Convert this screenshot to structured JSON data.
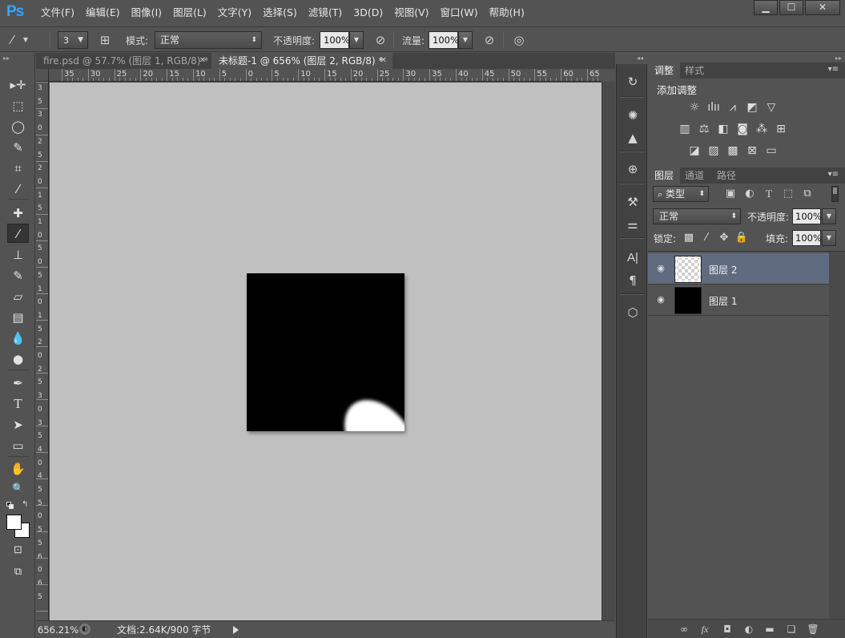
{
  "app": {
    "logo": "Ps"
  },
  "menu": [
    "文件(F)",
    "编辑(E)",
    "图像(I)",
    "图层(L)",
    "文字(Y)",
    "选择(S)",
    "滤镜(T)",
    "3D(D)",
    "视图(V)",
    "窗口(W)",
    "帮助(H)"
  ],
  "window_buttons": {
    "minimize": "▁",
    "maximize": "☐",
    "close": "✕"
  },
  "options": {
    "brush_size": "3",
    "mode_label": "模式:",
    "mode_value": "正常",
    "opacity_label": "不透明度:",
    "opacity_value": "100%",
    "flow_label": "流量:",
    "flow_value": "100%"
  },
  "tabs": [
    {
      "label": "fire.psd @ 57.7% (图层 1, RGB/8) *",
      "active": false
    },
    {
      "label": "未标题-1 @ 656% (图层 2, RGB/8) *",
      "active": true
    }
  ],
  "ruler": {
    "top": [
      "35",
      "30",
      "25",
      "20",
      "15",
      "10",
      "5",
      "0",
      "5",
      "10",
      "15",
      "20",
      "25",
      "30",
      "35",
      "40",
      "45",
      "50",
      "55",
      "60",
      "65"
    ],
    "left": [
      "3",
      "5",
      "3",
      "0",
      "2",
      "5",
      "2",
      "0",
      "1",
      "5",
      "1",
      "0",
      "5",
      "0",
      "5",
      "1",
      "0",
      "1",
      "5",
      "2",
      "0",
      "2",
      "5",
      "3",
      "0",
      "3",
      "5",
      "4",
      "0",
      "4",
      "5",
      "5",
      "0",
      "5",
      "5",
      "6",
      "0",
      "6",
      "5"
    ]
  },
  "tools": [
    {
      "name": "move-tool-icon",
      "glyph": "▸✛"
    },
    {
      "name": "marquee-tool-icon",
      "glyph": "⬚"
    },
    {
      "name": "lasso-tool-icon",
      "glyph": "◯"
    },
    {
      "name": "quick-select-tool-icon",
      "glyph": "✎"
    },
    {
      "name": "crop-tool-icon",
      "glyph": "⌗"
    },
    {
      "name": "eyedropper-tool-icon",
      "glyph": "⁄"
    },
    {
      "name": "healing-brush-tool-icon",
      "glyph": "✚"
    },
    {
      "name": "brush-tool-icon",
      "glyph": "⁄",
      "active": true
    },
    {
      "name": "clone-stamp-tool-icon",
      "glyph": "⊥"
    },
    {
      "name": "history-brush-tool-icon",
      "glyph": "✎"
    },
    {
      "name": "eraser-tool-icon",
      "glyph": "▱"
    },
    {
      "name": "gradient-tool-icon",
      "glyph": "▤"
    },
    {
      "name": "blur-tool-icon",
      "glyph": "💧"
    },
    {
      "name": "dodge-tool-icon",
      "glyph": "●"
    },
    {
      "name": "pen-tool-icon",
      "glyph": "✒"
    },
    {
      "name": "type-tool-icon",
      "glyph": "T"
    },
    {
      "name": "path-select-tool-icon",
      "glyph": "➤"
    },
    {
      "name": "shape-tool-icon",
      "glyph": "▭"
    },
    {
      "name": "hand-tool-icon",
      "glyph": "✋"
    },
    {
      "name": "zoom-tool-icon",
      "glyph": "🔍"
    }
  ],
  "colors": {
    "foreground": "#ffffff",
    "background": "#ffffff",
    "canvas_bg": "#c0c0c0",
    "selected_layer": "#5f6c80"
  },
  "status": {
    "zoom": "656.21%",
    "doc_info": "文档:2.64K/900 字节"
  },
  "adjustments_panel": {
    "tabs": [
      "调整",
      "样式"
    ],
    "title": "添加调整",
    "icons": [
      [
        "brightness-contrast-icon",
        "levels-icon",
        "curves-icon",
        "exposure-icon",
        "vibrance-icon"
      ],
      [
        "hue-saturation-icon",
        "color-balance-icon",
        "black-white-icon",
        "photo-filter-icon",
        "channel-mixer-icon",
        "color-lookup-icon"
      ],
      [
        "invert-icon",
        "posterize-icon",
        "threshold-icon",
        "selective-color-icon",
        "gradient-map-icon"
      ]
    ]
  },
  "layers_panel": {
    "tabs": [
      "图层",
      "通道",
      "路径"
    ],
    "filter_label": "类型",
    "blend_mode": "正常",
    "opacity_label": "不透明度:",
    "opacity_value": "100%",
    "lock_label": "锁定:",
    "fill_label": "填充:",
    "fill_value": "100%",
    "layers": [
      {
        "name": "图层 2",
        "thumbnail": "transparent",
        "selected": true,
        "visible": true
      },
      {
        "name": "图层 1",
        "thumbnail": "black",
        "selected": false,
        "visible": true
      }
    ],
    "footer_icons": [
      "link-layers-icon",
      "fx-icon",
      "add-mask-icon",
      "new-adjustment-icon",
      "new-group-icon",
      "new-layer-icon",
      "delete-layer-icon"
    ]
  }
}
